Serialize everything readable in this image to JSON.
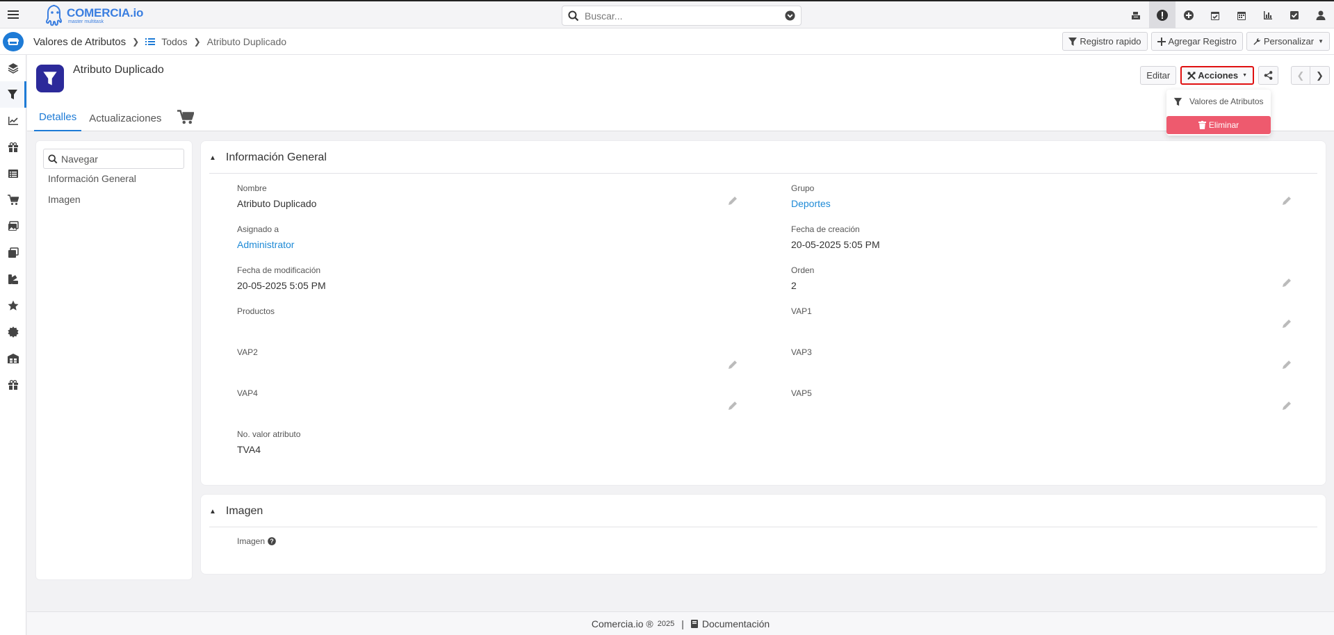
{
  "brand": {
    "name": "COMERCIA.io",
    "tagline": "master multitask"
  },
  "search": {
    "placeholder": "Buscar..."
  },
  "top_icons": [
    "cash-register-icon",
    "alert-icon",
    "plus-circle-icon",
    "calendar-check-icon",
    "calendar-icon",
    "bar-chart-icon",
    "check-square-icon",
    "user-icon"
  ],
  "breadcrumb": {
    "module": "Valores de Atributos",
    "list": "Todos",
    "record": "Atributo Duplicado"
  },
  "nav_buttons": {
    "quick": "Registro rapido",
    "add": "Agregar Registro",
    "customize": "Personalizar"
  },
  "record": {
    "title": "Atributo Duplicado"
  },
  "tabs": [
    "Detalles",
    "Actualizaciones"
  ],
  "actions": {
    "edit": "Editar",
    "actions": "Acciones"
  },
  "dropdown": {
    "item": "Valores de Atributos",
    "delete": "Eliminar"
  },
  "left_nav": {
    "placeholder": "Navegar",
    "items": [
      "Información General",
      "Imagen"
    ]
  },
  "panels": {
    "general": "Información General",
    "image": "Imagen"
  },
  "fields": {
    "nombre": {
      "label": "Nombre",
      "value": "Atributo Duplicado"
    },
    "grupo": {
      "label": "Grupo",
      "value": "Deportes"
    },
    "asignado": {
      "label": "Asignado a",
      "value": "Administrator"
    },
    "creacion": {
      "label": "Fecha de creación",
      "value": "20-05-2025 5:05 PM"
    },
    "modificacion": {
      "label": "Fecha de modificación",
      "value": "20-05-2025 5:05 PM"
    },
    "orden": {
      "label": "Orden",
      "value": "2"
    },
    "productos": {
      "label": "Productos",
      "value": ""
    },
    "vap1": {
      "label": "VAP1",
      "value": ""
    },
    "vap2": {
      "label": "VAP2",
      "value": ""
    },
    "vap3": {
      "label": "VAP3",
      "value": ""
    },
    "vap4": {
      "label": "VAP4",
      "value": ""
    },
    "vap5": {
      "label": "VAP5",
      "value": ""
    },
    "no_valor": {
      "label": "No. valor atributo",
      "value": "TVA4"
    },
    "imagen": {
      "label": "Imagen"
    }
  },
  "footer": {
    "brand": "Comercia.io ®",
    "year": "2025",
    "sep": "|",
    "docs": "Documentación"
  },
  "colors": {
    "accent": "#1e7bd6",
    "danger": "#ee5a6e",
    "record_icon": "#2c2a9a",
    "highlight": "#e01010"
  }
}
